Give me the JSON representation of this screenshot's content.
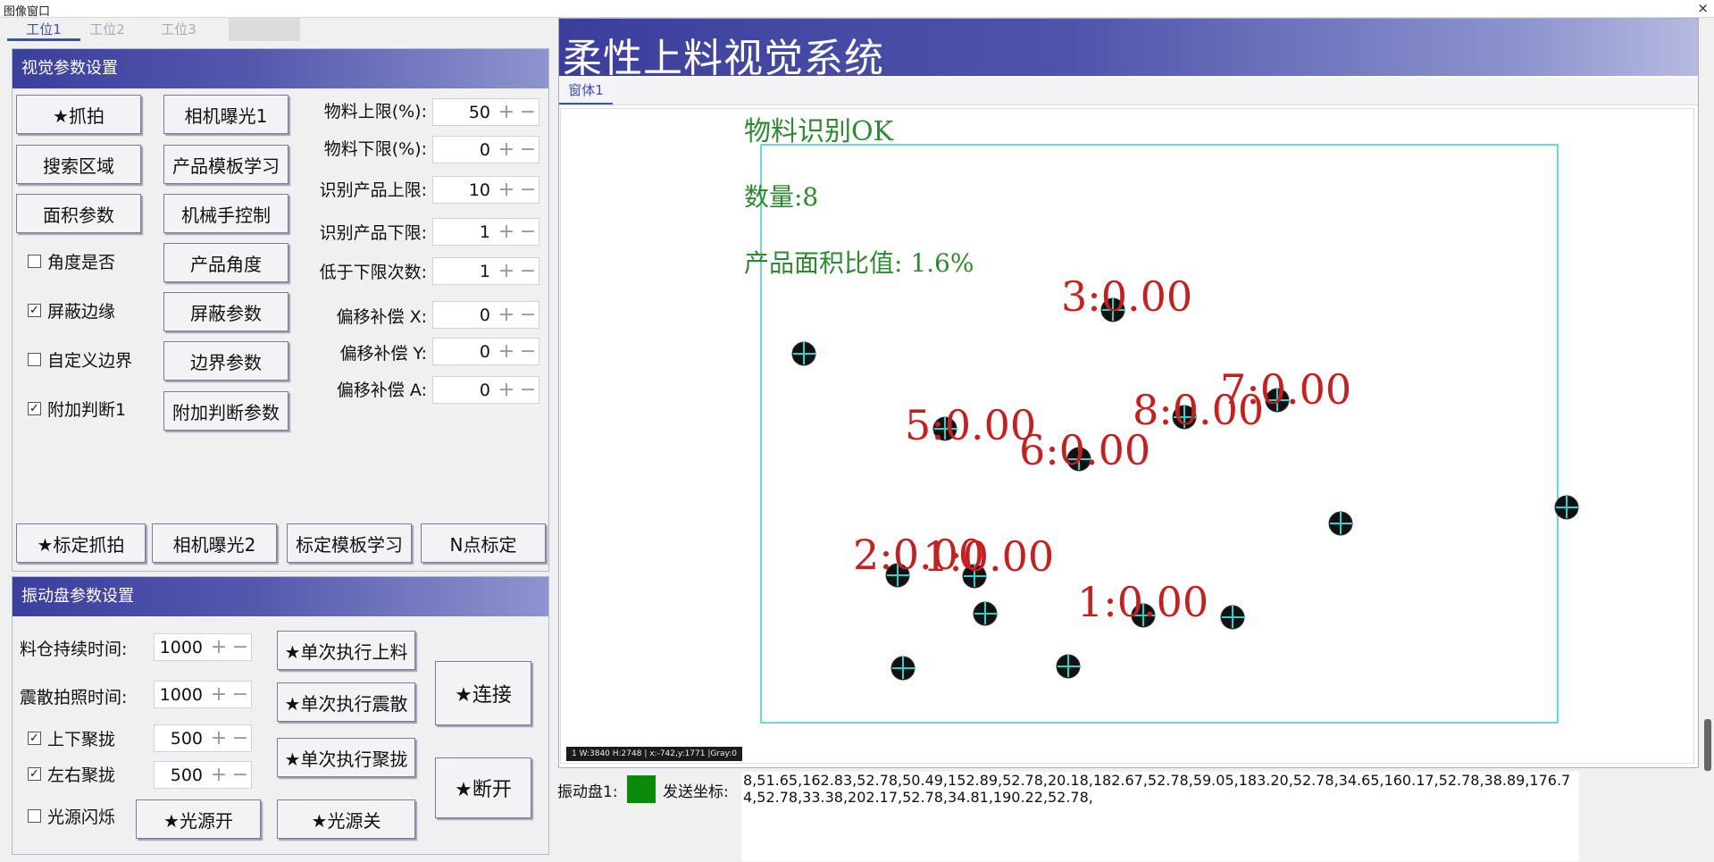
{
  "window": {
    "title": "图像窗口",
    "close": "×"
  },
  "station_tabs": [
    "工位1",
    "工位2",
    "工位3"
  ],
  "vision_panel": {
    "title": "视觉参数设置",
    "buttons": {
      "capture": "★抓拍",
      "exposure1": "相机曝光1",
      "search_area": "搜索区域",
      "template_learn": "产品模板学习",
      "area_params": "面积参数",
      "robot_control": "机械手控制",
      "product_angle": "产品角度",
      "mask_params": "屏蔽参数",
      "boundary_params": "边界参数",
      "extra_judge_params": "附加判断参数",
      "calib_capture": "★标定抓拍",
      "exposure2": "相机曝光2",
      "calib_template": "标定模板学习",
      "n_point_calib": "N点标定"
    },
    "checkboxes": [
      {
        "label": "角度是否",
        "checked": false
      },
      {
        "label": "屏蔽边缘",
        "checked": true
      },
      {
        "label": "自定义边界",
        "checked": false
      },
      {
        "label": "附加判断1",
        "checked": true
      }
    ],
    "params": [
      {
        "label": "物料上限(%):",
        "value": "50"
      },
      {
        "label": "物料下限(%):",
        "value": "0"
      },
      {
        "label": "识别产品上限:",
        "value": "10"
      },
      {
        "label": "识别产品下限:",
        "value": "1"
      },
      {
        "label": "低于下限次数:",
        "value": "1"
      },
      {
        "label": "偏移补偿 X:",
        "value": "0"
      },
      {
        "label": "偏移补偿 Y:",
        "value": "0"
      },
      {
        "label": "偏移补偿 A:",
        "value": "0"
      }
    ]
  },
  "vibration_panel": {
    "title": "振动盘参数设置",
    "params": [
      {
        "label": "料仓持续时间:",
        "value": "1000"
      },
      {
        "label": "震散拍照时间:",
        "value": "1000"
      }
    ],
    "checkboxes": [
      {
        "label": "上下聚拢",
        "checked": true,
        "value": "500"
      },
      {
        "label": "左右聚拢",
        "checked": true,
        "value": "500"
      },
      {
        "label": "光源闪烁",
        "checked": false
      }
    ],
    "buttons": {
      "single_feed": "★单次执行上料",
      "single_scatter": "★单次执行震散",
      "single_gather": "★单次执行聚拢",
      "connect": "★连接",
      "disconnect": "★断开",
      "light_on": "★光源开",
      "light_off": "★光源关"
    }
  },
  "display": {
    "title": "柔性上料视觉系统",
    "sub_tab": "窗体1",
    "overlay": {
      "status": "物料识别OK",
      "count": "数量:8",
      "area_ratio": "产品面积比值: 1.6%"
    },
    "detections": [
      {
        "label": "3:0.00"
      },
      {
        "label": "7:0.00"
      },
      {
        "label": "8:0.00"
      },
      {
        "label": "5:0.00"
      },
      {
        "label": "6:0.00"
      },
      {
        "label": "2:0.00"
      },
      {
        "label": "1:0.00"
      },
      {
        "label": "1:0.00"
      }
    ],
    "status_bar": "1  W:3840 H:2748 | x:-742,y:1771  |Gray:0"
  },
  "bottom": {
    "vib_label": "振动盘1:",
    "vib_status_color": "#0a8a0a",
    "send_label": "发送坐标:",
    "coords": "8,51.65,162.83,52.78,50.49,152.89,52.78,20.18,182.67,52.78,59.05,183.20,52.78,34.65,160.17,52.78,38.89,176.74,52.78,33.38,202.17,52.78,34.81,190.22,52.78,"
  }
}
